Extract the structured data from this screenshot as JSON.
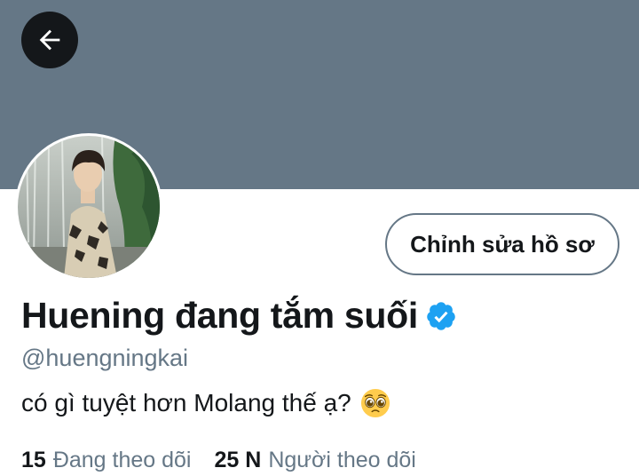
{
  "profile": {
    "display_name": "Huening đang tắm suối",
    "handle": "@huengningkai",
    "bio": "có gì tuyệt hơn Molang thế ạ?",
    "bio_emoji": "pleading-face-emoji",
    "verified": true,
    "edit_button_label": "Chỉnh sửa hồ sơ"
  },
  "stats": {
    "following_count": "15",
    "following_label": "Đang theo dõi",
    "followers_count": "25 N",
    "followers_label": "Người theo dõi"
  },
  "icons": {
    "back": "arrow-left-icon",
    "verified": "verified-badge-icon"
  },
  "colors": {
    "banner": "#657786",
    "accent": "#1da1f2",
    "text_primary": "#14171a",
    "text_secondary": "#657786"
  }
}
